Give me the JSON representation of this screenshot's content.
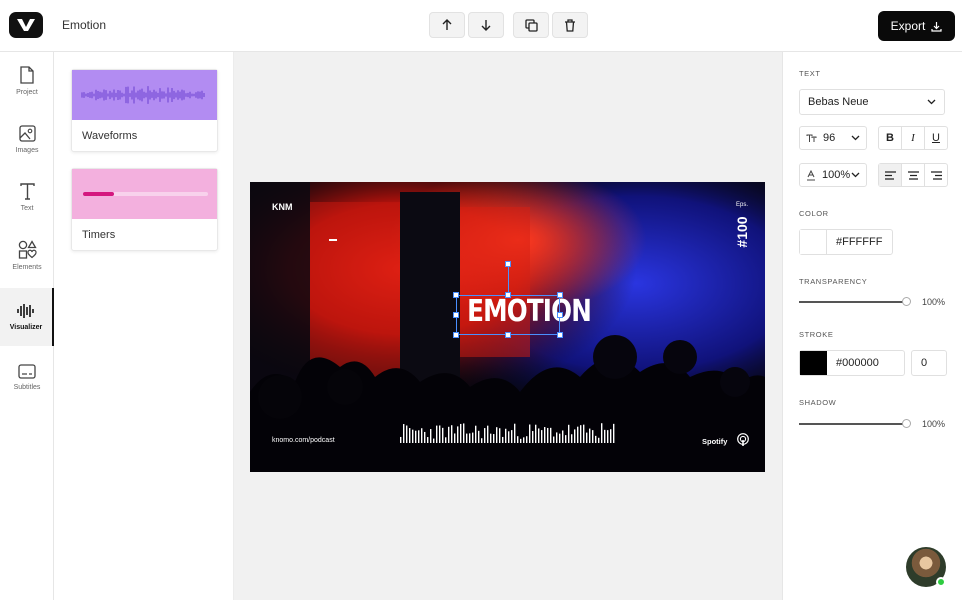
{
  "header": {
    "project_name": "Emotion",
    "export_label": "Export",
    "toolbar_icons": [
      "arrow-up-icon",
      "arrow-down-icon",
      "duplicate-icon",
      "trash-icon"
    ]
  },
  "sidebar": {
    "items": [
      {
        "label": "Project",
        "icon": "file-icon"
      },
      {
        "label": "Images",
        "icon": "image-icon"
      },
      {
        "label": "Text",
        "icon": "text-icon"
      },
      {
        "label": "Elements",
        "icon": "shapes-icon"
      },
      {
        "label": "Visualizer",
        "icon": "waveform-icon",
        "active": true
      },
      {
        "label": "Subtitles",
        "icon": "subtitles-icon"
      }
    ]
  },
  "panel": {
    "cards": [
      {
        "label": "Waveforms",
        "color": "#b28cf2"
      },
      {
        "label": "Timers",
        "color": "#f3b0de"
      }
    ]
  },
  "stage": {
    "brand": "KNM",
    "episode_label": "Eps.",
    "episode_number": "#100",
    "headline": "EMOTION",
    "url": "knomo.com/podcast",
    "platform": "Spotify"
  },
  "properties": {
    "text_label": "TEXT",
    "font": "Bebas Neue",
    "font_size": "96",
    "line_height": "100%",
    "format_buttons": [
      "B",
      "I",
      "U"
    ],
    "color_label": "COLOR",
    "color_value": "#FFFFFF",
    "transparency_label": "TRANSPARENCY",
    "transparency": "100%",
    "stroke_label": "STROKE",
    "stroke_color": "#000000",
    "stroke_width": "0",
    "shadow_label": "SHADOW",
    "shadow": "100%"
  }
}
